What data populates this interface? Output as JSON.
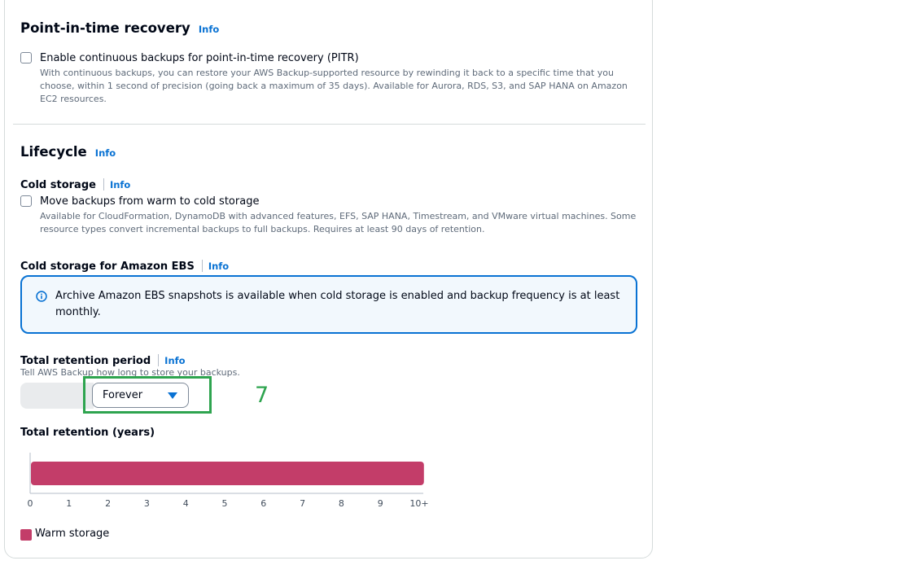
{
  "pitr": {
    "title": "Point-in-time recovery",
    "info": "Info",
    "checkbox_label": "Enable continuous backups for point-in-time recovery (PITR)",
    "description_lines": [
      "With continuous backups, you can restore your AWS Backup-supported resource by rewinding it back to a specific time that you",
      "choose, within 1 second of precision (going back a maximum of 35 days). Available for Aurora, RDS, S3, and SAP HANA on Amazon",
      "EC2 resources."
    ]
  },
  "lifecycle": {
    "title": "Lifecycle",
    "info": "Info",
    "cold_storage": {
      "label": "Cold storage",
      "info": "Info",
      "checkbox_label": "Move backups from warm to cold storage",
      "description_lines": [
        "Available for CloudFormation, DynamoDB with advanced features, EFS, SAP HANA, Timestream, and VMware virtual machines. Some",
        "resource types convert incremental backups to full backups. Requires at least 90 days of retention."
      ]
    },
    "cold_storage_ebs": {
      "label": "Cold storage for Amazon EBS",
      "info": "Info",
      "alert_lines": [
        "Archive Amazon EBS snapshots is available when cold storage is enabled and backup frequency is at least",
        "monthly."
      ]
    },
    "total_retention_period": {
      "label": "Total retention period",
      "info": "Info",
      "description": "Tell AWS Backup how long to store your backups.",
      "selected_value": "Forever"
    },
    "annotation_number": "7"
  },
  "chart_data": {
    "type": "bar",
    "title": "Total retention (years)",
    "categories": [
      "Warm storage"
    ],
    "series": [
      {
        "name": "Warm storage",
        "values": [
          10.1
        ]
      }
    ],
    "xlim": [
      0,
      10
    ],
    "tick_labels": [
      "0",
      "1",
      "2",
      "3",
      "4",
      "5",
      "6",
      "7",
      "8",
      "9",
      "10+"
    ],
    "colors": {
      "warm": "#c33d69"
    },
    "legend": "bottom-left",
    "orientation": "horizontal"
  },
  "colors": {
    "accent": "#0972d3",
    "highlight": "#2ea44f"
  }
}
